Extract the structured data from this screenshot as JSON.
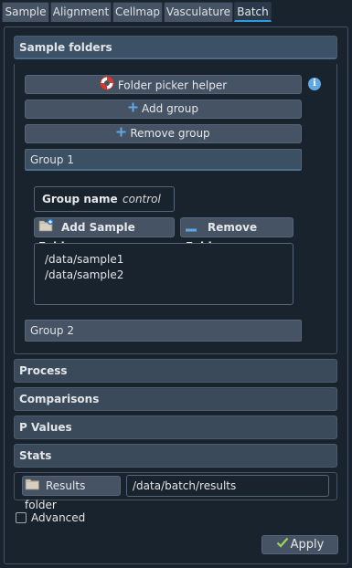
{
  "tabs": [
    {
      "label": "Sample"
    },
    {
      "label": "Alignment"
    },
    {
      "label": "Cellmap"
    },
    {
      "label": "Vasculature"
    },
    {
      "label": "Batch"
    }
  ],
  "sections": {
    "sample_folders": "Sample folders",
    "process": "Process",
    "comparisons": "Comparisons",
    "p_values": "P Values",
    "stats": "Stats"
  },
  "buttons": {
    "folder_picker_helper": "Folder picker helper",
    "add_group": "Add group",
    "remove_group": "Remove group",
    "add_sample_folder": "Add Sample Folder",
    "remove_folder": "Remove Folder",
    "results_folder": "Results folder",
    "apply": "Apply"
  },
  "groups": [
    {
      "label": "Group 1",
      "name_label": "Group name",
      "name_value": "control",
      "folders": [
        "/data/sample1",
        "/data/sample2"
      ]
    },
    {
      "label": "Group 2"
    }
  ],
  "results_path": "/data/batch/results",
  "advanced_label": "Advanced",
  "colors": {
    "background": "#19232d",
    "button": "#455364",
    "accent": "#2d9be2",
    "section_header": "#3b4a5b"
  }
}
